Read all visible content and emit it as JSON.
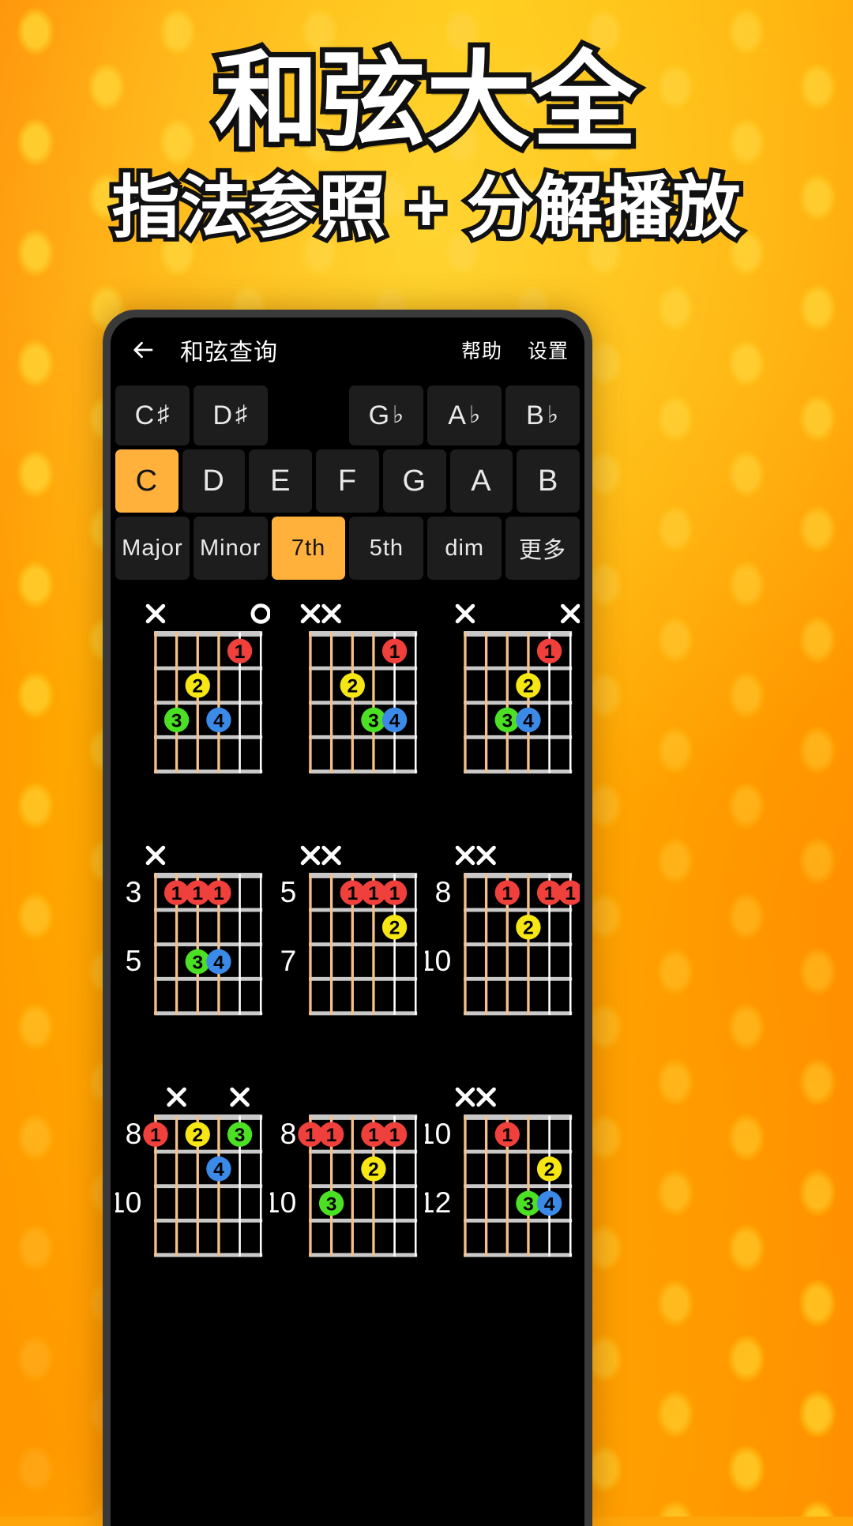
{
  "promo": {
    "title": "和弦大全",
    "subtitle": "指法参照 + 分解播放"
  },
  "appbar": {
    "back_icon": "arrow-left-icon",
    "title": "和弦查询",
    "help_label": "帮助",
    "settings_label": "设置"
  },
  "colors": {
    "accent": "#FFB13C",
    "chip_bg": "#1d1d1d",
    "screen_bg": "#000000",
    "finger1": "#F0403C",
    "finger2": "#F5E614",
    "finger3": "#4CE024",
    "finger4": "#3C8AE8",
    "string_wound": "#F5C08A",
    "string_plain": "#FFFFFF",
    "fret": "#C9C9C9"
  },
  "accidental_row": [
    {
      "label": "C",
      "symbol": "♯",
      "active": false,
      "blank": false
    },
    {
      "label": "D",
      "symbol": "♯",
      "active": false,
      "blank": false
    },
    {
      "label": "",
      "symbol": "",
      "active": false,
      "blank": true
    },
    {
      "label": "G",
      "symbol": "♭",
      "active": false,
      "blank": false
    },
    {
      "label": "A",
      "symbol": "♭",
      "active": false,
      "blank": false
    },
    {
      "label": "B",
      "symbol": "♭",
      "active": false,
      "blank": false
    }
  ],
  "note_row": [
    {
      "label": "C",
      "active": true
    },
    {
      "label": "D",
      "active": false
    },
    {
      "label": "E",
      "active": false
    },
    {
      "label": "F",
      "active": false
    },
    {
      "label": "G",
      "active": false
    },
    {
      "label": "A",
      "active": false
    },
    {
      "label": "B",
      "active": false
    }
  ],
  "type_row": [
    {
      "label": "Major",
      "active": false
    },
    {
      "label": "Minor",
      "active": false
    },
    {
      "label": "7th",
      "active": true
    },
    {
      "label": "5th",
      "active": false
    },
    {
      "label": "dim",
      "active": false
    },
    {
      "label": "更多",
      "active": false
    }
  ],
  "chord_diagrams": [
    {
      "id": "c7-shape-1",
      "base_fret": null,
      "base_fret_secondary": null,
      "open_nut": true,
      "markers": [
        "x",
        "",
        "",
        "",
        "",
        "o"
      ],
      "dots": [
        {
          "string": 5,
          "fret": 1,
          "finger": "1"
        },
        {
          "string": 3,
          "fret": 2,
          "finger": "2"
        },
        {
          "string": 2,
          "fret": 3,
          "finger": "3"
        },
        {
          "string": 4,
          "fret": 3,
          "finger": "4"
        }
      ]
    },
    {
      "id": "c7-shape-2",
      "base_fret": null,
      "base_fret_secondary": null,
      "open_nut": true,
      "markers": [
        "x",
        "x",
        "",
        "",
        "",
        ""
      ],
      "dots": [
        {
          "string": 5,
          "fret": 1,
          "finger": "1"
        },
        {
          "string": 3,
          "fret": 2,
          "finger": "2"
        },
        {
          "string": 4,
          "fret": 3,
          "finger": "3"
        },
        {
          "string": 5,
          "fret": 3,
          "finger": "4"
        }
      ]
    },
    {
      "id": "c7-shape-3",
      "base_fret": null,
      "base_fret_secondary": null,
      "open_nut": true,
      "markers": [
        "x",
        "",
        "",
        "",
        "",
        "x"
      ],
      "dots": [
        {
          "string": 5,
          "fret": 1,
          "finger": "1"
        },
        {
          "string": 4,
          "fret": 2,
          "finger": "2"
        },
        {
          "string": 3,
          "fret": 3,
          "finger": "3"
        },
        {
          "string": 4,
          "fret": 3,
          "finger": "4"
        }
      ]
    },
    {
      "id": "c7-shape-4",
      "base_fret": "3",
      "base_fret_secondary": "5",
      "open_nut": false,
      "markers": [
        "x",
        "",
        "",
        "",
        "",
        ""
      ],
      "dots": [
        {
          "string": 2,
          "fret": 1,
          "finger": "1"
        },
        {
          "string": 3,
          "fret": 1,
          "finger": "1"
        },
        {
          "string": 4,
          "fret": 1,
          "finger": "1"
        },
        {
          "string": 3,
          "fret": 3,
          "finger": "3"
        },
        {
          "string": 4,
          "fret": 3,
          "finger": "4"
        }
      ]
    },
    {
      "id": "c7-shape-5",
      "base_fret": "5",
      "base_fret_secondary": "7",
      "open_nut": false,
      "markers": [
        "x",
        "x",
        "",
        "",
        "",
        ""
      ],
      "dots": [
        {
          "string": 3,
          "fret": 1,
          "finger": "1"
        },
        {
          "string": 4,
          "fret": 1,
          "finger": "1"
        },
        {
          "string": 5,
          "fret": 1,
          "finger": "1"
        },
        {
          "string": 5,
          "fret": 2,
          "finger": "2"
        }
      ]
    },
    {
      "id": "c7-shape-6",
      "base_fret": "8",
      "base_fret_secondary": "10",
      "open_nut": false,
      "markers": [
        "x",
        "x",
        "",
        "",
        "",
        ""
      ],
      "dots": [
        {
          "string": 3,
          "fret": 1,
          "finger": "1"
        },
        {
          "string": 5,
          "fret": 1,
          "finger": "1"
        },
        {
          "string": 6,
          "fret": 1,
          "finger": "1"
        },
        {
          "string": 4,
          "fret": 2,
          "finger": "2"
        }
      ]
    },
    {
      "id": "c7-shape-7",
      "base_fret": "8",
      "base_fret_secondary": "10",
      "open_nut": false,
      "markers": [
        "",
        "x",
        "",
        "",
        "x",
        ""
      ],
      "dots": [
        {
          "string": 1,
          "fret": 1,
          "finger": "1"
        },
        {
          "string": 3,
          "fret": 1,
          "finger": "2"
        },
        {
          "string": 5,
          "fret": 1,
          "finger": "3"
        },
        {
          "string": 4,
          "fret": 2,
          "finger": "4"
        }
      ]
    },
    {
      "id": "c7-shape-8",
      "base_fret": "8",
      "base_fret_secondary": "10",
      "open_nut": false,
      "markers": [
        "",
        "",
        "",
        "",
        "",
        ""
      ],
      "dots": [
        {
          "string": 1,
          "fret": 1,
          "finger": "1"
        },
        {
          "string": 2,
          "fret": 1,
          "finger": "1"
        },
        {
          "string": 4,
          "fret": 1,
          "finger": "1"
        },
        {
          "string": 5,
          "fret": 1,
          "finger": "1"
        },
        {
          "string": 4,
          "fret": 2,
          "finger": "2"
        },
        {
          "string": 2,
          "fret": 3,
          "finger": "3"
        }
      ]
    },
    {
      "id": "c7-shape-9",
      "base_fret": "10",
      "base_fret_secondary": "12",
      "open_nut": false,
      "markers": [
        "x",
        "x",
        "",
        "",
        "",
        ""
      ],
      "dots": [
        {
          "string": 3,
          "fret": 1,
          "finger": "1"
        },
        {
          "string": 5,
          "fret": 2,
          "finger": "2"
        },
        {
          "string": 4,
          "fret": 3,
          "finger": "3"
        },
        {
          "string": 5,
          "fret": 3,
          "finger": "4"
        }
      ]
    }
  ]
}
